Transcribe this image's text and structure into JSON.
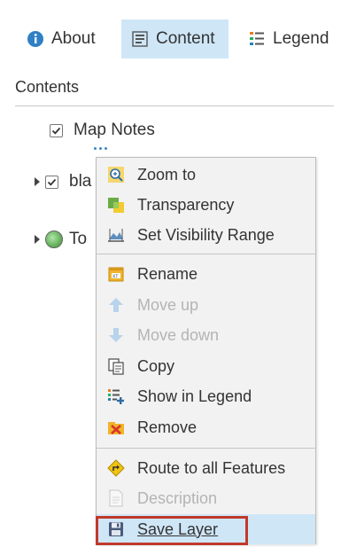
{
  "tabs": [
    {
      "label": "About",
      "icon": "info-icon"
    },
    {
      "label": "Content",
      "icon": "content-icon",
      "active": true
    },
    {
      "label": "Legend",
      "icon": "legend-icon"
    }
  ],
  "section_title": "Contents",
  "layers": {
    "map_notes": "Map Notes",
    "basemap1": "bla",
    "basemap2": "To"
  },
  "menu": {
    "items": [
      {
        "label": "Zoom to",
        "icon": "zoom-to-icon",
        "enabled": true
      },
      {
        "label": "Transparency",
        "icon": "transparency-icon",
        "enabled": true
      },
      {
        "label": "Set Visibility Range",
        "icon": "visibility-range-icon",
        "enabled": true
      },
      {
        "label": "Rename",
        "icon": "rename-icon",
        "enabled": true
      },
      {
        "label": "Move up",
        "icon": "arrow-up-icon",
        "enabled": false
      },
      {
        "label": "Move down",
        "icon": "arrow-down-icon",
        "enabled": false
      },
      {
        "label": "Copy",
        "icon": "copy-icon",
        "enabled": true
      },
      {
        "label": "Show in Legend",
        "icon": "show-in-legend-icon",
        "enabled": true
      },
      {
        "label": "Remove",
        "icon": "remove-icon",
        "enabled": true
      },
      {
        "label": "Route to all Features",
        "icon": "route-icon",
        "enabled": true
      },
      {
        "label": "Description",
        "icon": "description-icon",
        "enabled": false
      },
      {
        "label": "Save Layer",
        "icon": "save-icon",
        "enabled": true
      }
    ]
  },
  "colors": {
    "accent": "#3b86c9",
    "active_tab_bg": "#cfe6f7",
    "highlight_border": "#c0392b",
    "disabled_text": "#b4b4b4"
  }
}
